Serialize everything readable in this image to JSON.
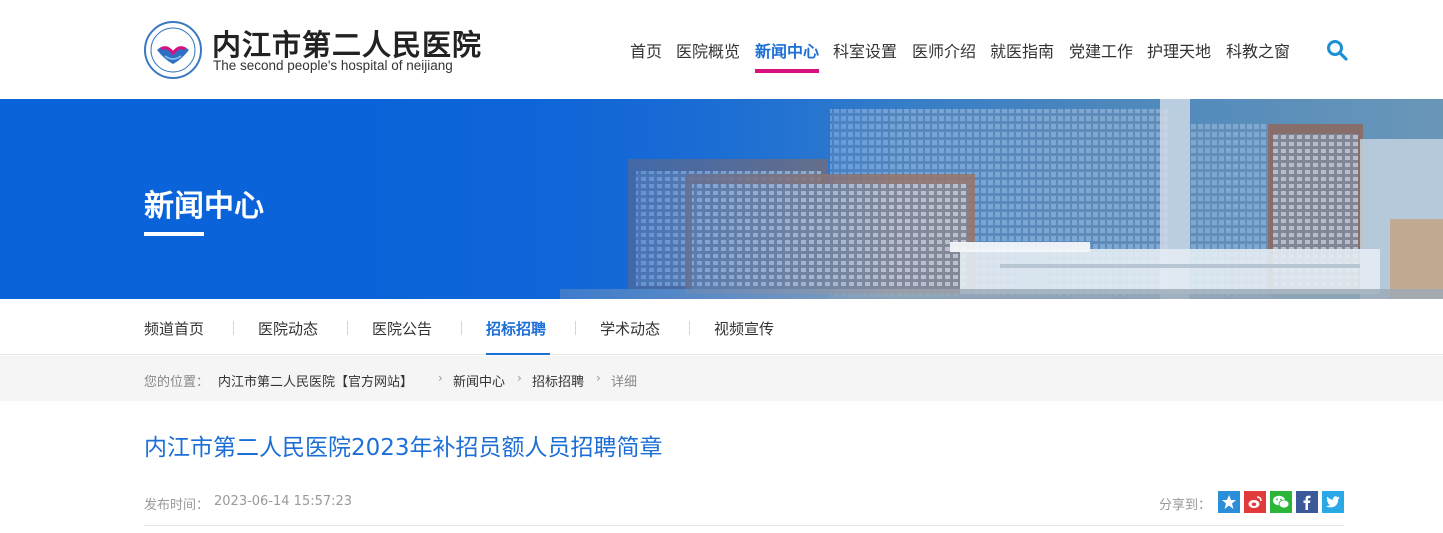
{
  "header": {
    "logo_cn": "内江市第二人民医院",
    "logo_en": "The second people's hospital of neijiang",
    "nav": [
      {
        "label": "首页"
      },
      {
        "label": "医院概览"
      },
      {
        "label": "新闻中心",
        "active": true
      },
      {
        "label": "科室设置"
      },
      {
        "label": "医师介绍"
      },
      {
        "label": "就医指南"
      },
      {
        "label": "党建工作"
      },
      {
        "label": "护理天地"
      },
      {
        "label": "科教之窗"
      }
    ],
    "search_icon": "search-icon",
    "accent_color": "#d9117f"
  },
  "banner": {
    "title": "新闻中心"
  },
  "subnav": {
    "items": [
      {
        "label": "频道首页"
      },
      {
        "label": "医院动态"
      },
      {
        "label": "医院公告"
      },
      {
        "label": "招标招聘",
        "active": true
      },
      {
        "label": "学术动态"
      },
      {
        "label": "视频宣传"
      }
    ]
  },
  "breadcrumb": {
    "label": "您的位置：",
    "items": [
      "内江市第二人民医院【官方网站】",
      "新闻中心",
      "招标招聘",
      "详细"
    ]
  },
  "article": {
    "title": "内江市第二人民医院2023年补招员额人员招聘简章",
    "publish_label": "发布时间：",
    "publish_time": "2023-06-14 15:57:23",
    "share_label": "分享到：",
    "share_icons": [
      "qzone-icon",
      "weibo-icon",
      "wechat-icon",
      "facebook-icon",
      "twitter-icon"
    ]
  },
  "colors": {
    "primary": "#1d6fd6",
    "banner": "#0b63d9"
  }
}
